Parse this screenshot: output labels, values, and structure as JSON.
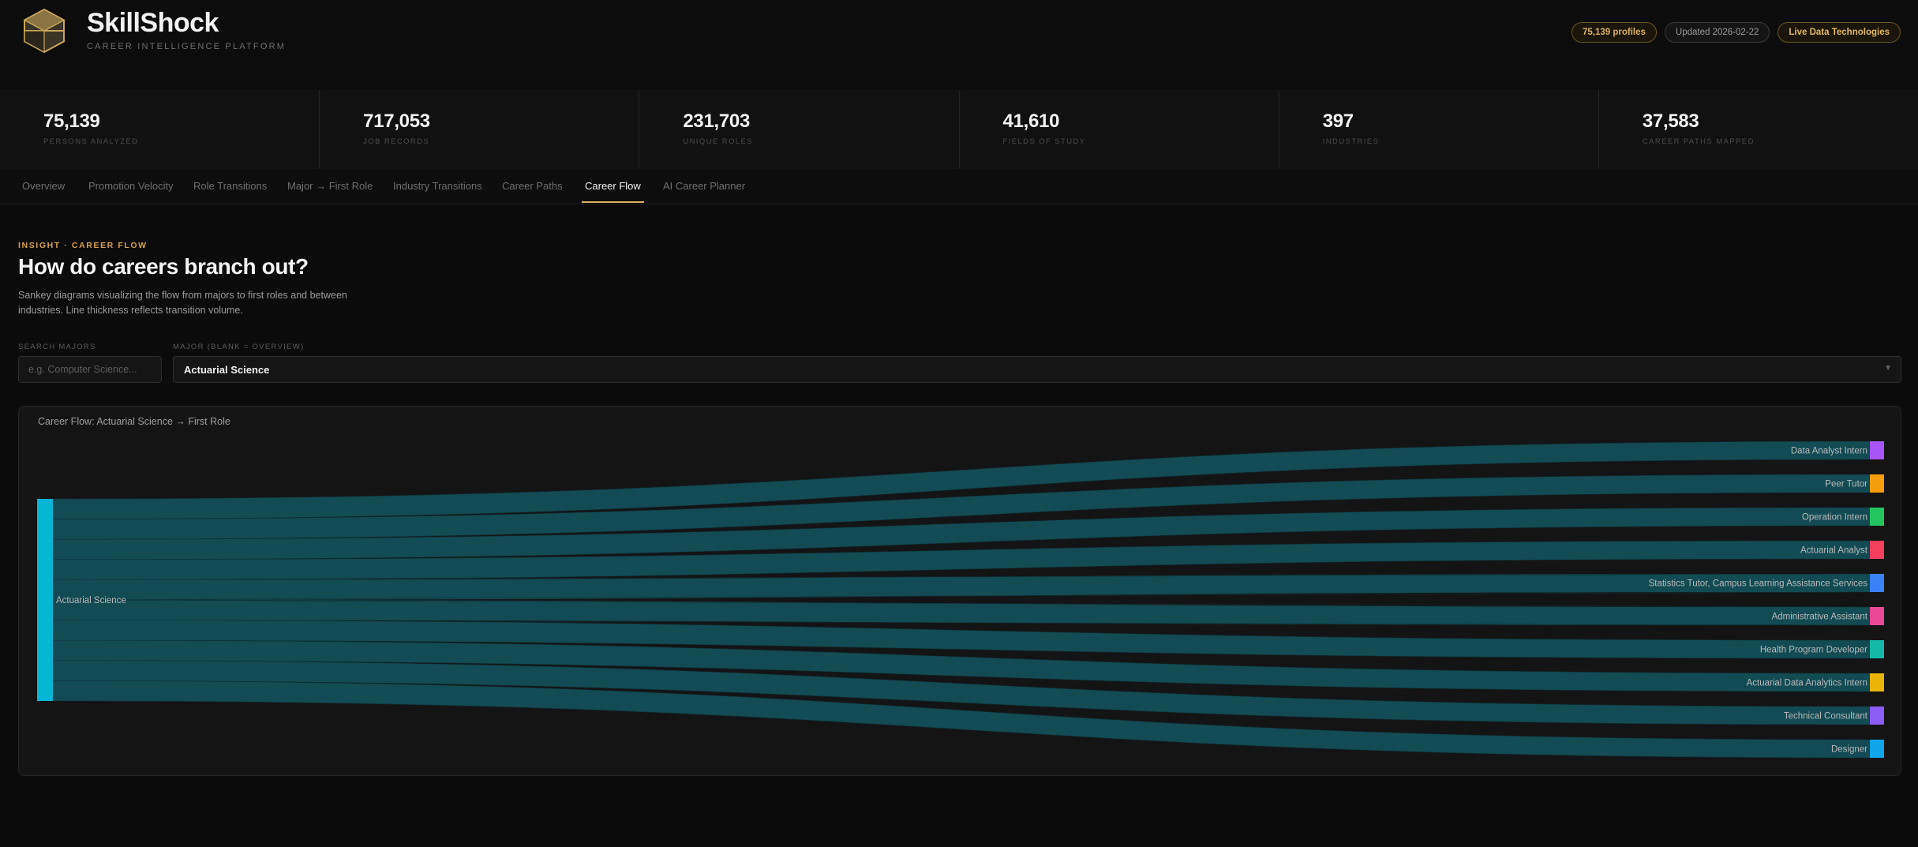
{
  "brand": {
    "name": "SkillShock",
    "tagline": "CAREER INTELLIGENCE PLATFORM",
    "logo_icon": "hexagon-cube-icon",
    "accent": "#d9b160"
  },
  "header_pills": {
    "profiles": "75,139 profiles",
    "updated": "Updated 2026-02-22",
    "source": "Live Data Technologies"
  },
  "stats": [
    {
      "value": "75,139",
      "label": "PERSONS ANALYZED"
    },
    {
      "value": "717,053",
      "label": "JOB RECORDS"
    },
    {
      "value": "231,703",
      "label": "UNIQUE ROLES"
    },
    {
      "value": "41,610",
      "label": "FIELDS OF STUDY"
    },
    {
      "value": "397",
      "label": "INDUSTRIES"
    },
    {
      "value": "37,583",
      "label": "CAREER PATHS MAPPED"
    }
  ],
  "tabs": [
    {
      "label": "Overview",
      "active": false
    },
    {
      "label": "Promotion Velocity",
      "active": false
    },
    {
      "label": "Role Transitions",
      "active": false
    },
    {
      "label": "Major → First Role",
      "active": false
    },
    {
      "label": "Industry Transitions",
      "active": false
    },
    {
      "label": "Career Paths",
      "active": false
    },
    {
      "label": "Career Flow",
      "active": true
    },
    {
      "label": "AI Career Planner",
      "active": false
    }
  ],
  "insight": {
    "eyebrow": "INSIGHT · CAREER FLOW",
    "title": "How do careers branch out?",
    "description": "Sankey diagrams visualizing the flow from majors to first roles and between industries. Line thickness reflects transition volume."
  },
  "controls": {
    "search_label": "SEARCH MAJORS",
    "search_placeholder": "e.g. Computer Science...",
    "search_value": "",
    "major_label": "MAJOR (BLANK = OVERVIEW)",
    "major_value": "Actuarial Science"
  },
  "chart_data": {
    "type": "sankey",
    "title": "Career Flow: Actuarial Science → First Role",
    "source": {
      "name": "Actuarial Science",
      "color": "#06b6d4"
    },
    "link_color": "#134e57",
    "targets": [
      {
        "name": "Data Analyst Intern",
        "value": 1,
        "color": "#a855f7"
      },
      {
        "name": "Peer Tutor",
        "value": 1,
        "color": "#f59e0b"
      },
      {
        "name": "Operation Intern",
        "value": 1,
        "color": "#22c55e"
      },
      {
        "name": "Actuarial Analyst",
        "value": 1,
        "color": "#f43f5e"
      },
      {
        "name": "Statistics Tutor, Campus Learning Assistance Services",
        "value": 1,
        "color": "#3b82f6"
      },
      {
        "name": "Administrative Assistant",
        "value": 1,
        "color": "#ec4899"
      },
      {
        "name": "Health Program Developer",
        "value": 1,
        "color": "#14b8a6"
      },
      {
        "name": "Actuarial Data Analytics Intern",
        "value": 1,
        "color": "#eab308"
      },
      {
        "name": "Technical Consultant",
        "value": 1,
        "color": "#8b5cf6"
      },
      {
        "name": "Designer",
        "value": 1,
        "color": "#0ea5e9"
      }
    ]
  }
}
